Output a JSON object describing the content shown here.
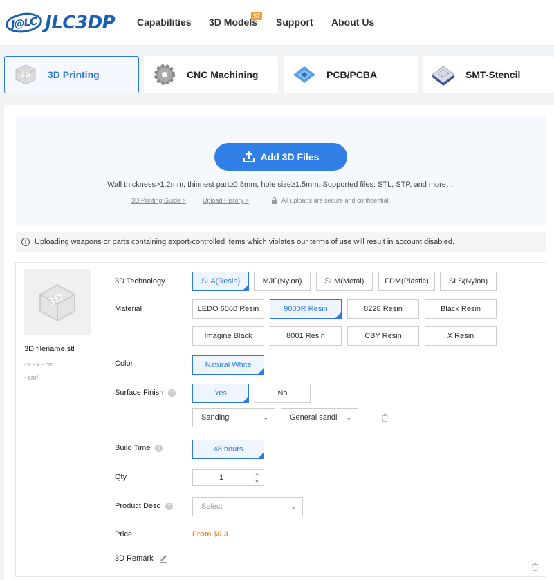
{
  "header": {
    "logo_badge": "J@LC",
    "logo_text": "JLC3DP",
    "nav": [
      "Capabilities",
      "3D Models",
      "Support",
      "About Us"
    ],
    "nav_badge": "$7"
  },
  "service_tabs": [
    {
      "label": "3D Printing",
      "icon": "3d-printing-icon",
      "active": true
    },
    {
      "label": "CNC Machining",
      "icon": "gear-icon",
      "active": false
    },
    {
      "label": "PCB/PCBA",
      "icon": "pcb-icon",
      "active": false
    },
    {
      "label": "SMT-Stencil",
      "icon": "stencil-icon",
      "active": false
    }
  ],
  "upload": {
    "button_label": "Add 3D Files",
    "hint": "Wall thickness>1.2mm, thinnest part≥0.8mm, hole size≥1.5mm. Supported files: STL, STP, and more…",
    "guide_link": "3D Printing Guide >",
    "history_link": "Upload History >",
    "secure_text": "All uploads are secure and confidential."
  },
  "warning": {
    "before": "Uploading weapons or parts containing export-controlled items which violates our",
    "terms": "terms of use",
    "after": "will result in account disabled."
  },
  "file": {
    "name": "3D filename.stl",
    "dims": "- x - x - cm",
    "volume": "- cm³"
  },
  "form": {
    "technology_label": "3D Technology",
    "technologies": [
      "SLA(Resin)",
      "MJF(Nylon)",
      "SLM(Metal)",
      "FDM(Plastic)",
      "SLS(Nylon)"
    ],
    "material_label": "Material",
    "materials": [
      "LEDO 6060 Resin",
      "9000R Resin",
      "8228 Resin",
      "Black Resin",
      "Imagine Black",
      "8001 Resin",
      "CBY Resin",
      "X Resin"
    ],
    "color_label": "Color",
    "color": "Natural White",
    "surface_label": "Surface Finish",
    "surface_yes": "Yes",
    "surface_no": "No",
    "finish_type": "Sanding",
    "finish_detail": "General sandi",
    "build_label": "Build Time",
    "build_time": "48 hours",
    "qty_label": "Qty",
    "qty": "1",
    "desc_label": "Product Desc",
    "desc_placeholder": "Select",
    "price_label": "Price",
    "price": "From $0.3",
    "remark_label": "3D Remark"
  },
  "colors": {
    "brand": "#1a5fb4",
    "accent": "#2a7ae2",
    "price": "#f08c28"
  }
}
